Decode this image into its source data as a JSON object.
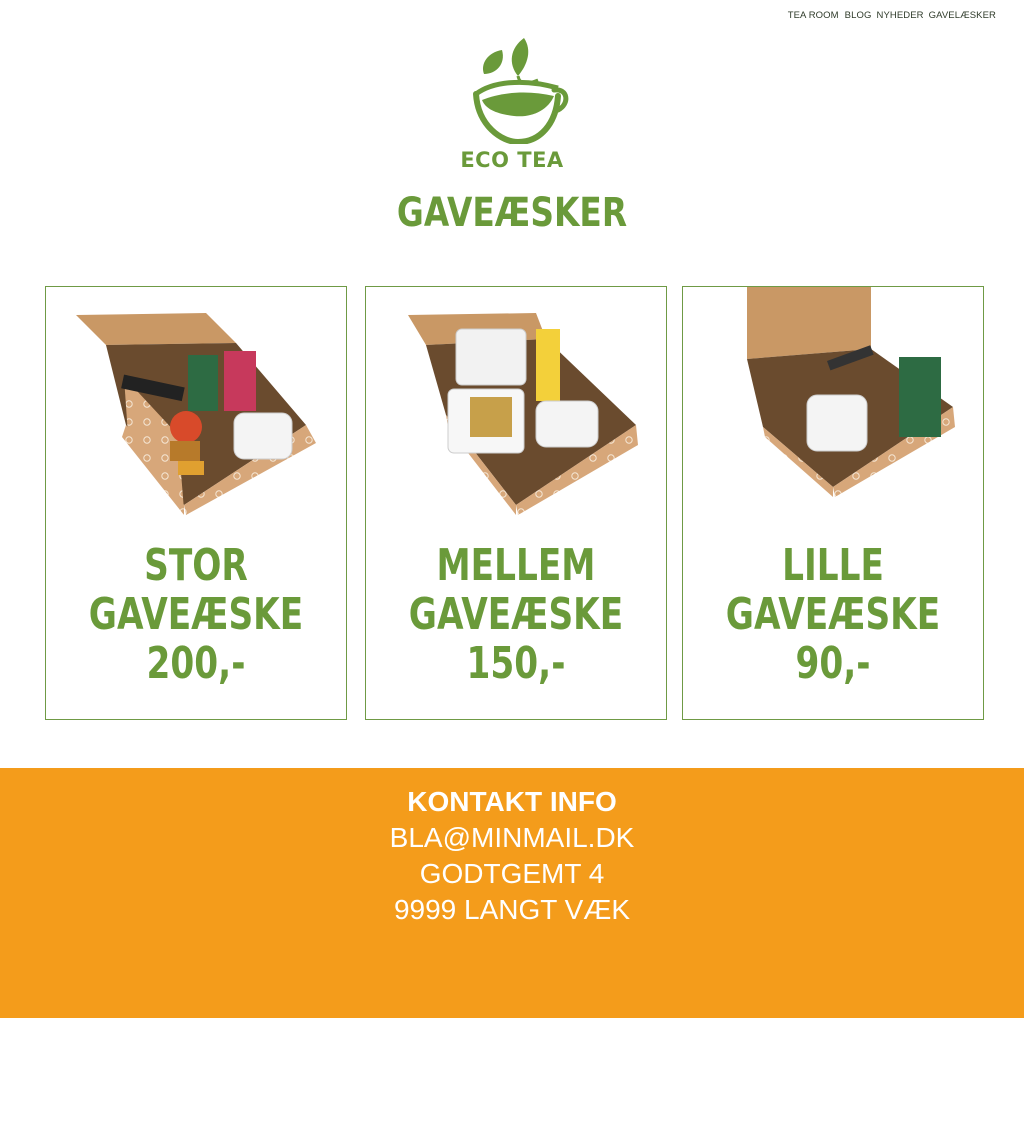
{
  "nav": {
    "items": [
      "TEA ROOM",
      "BLOG",
      "NYHEDER",
      "GAVELÆSKER"
    ]
  },
  "logo": {
    "text": "ECO TEA",
    "icon": "tea-cup-leaf-icon",
    "color": "#6a9a3a"
  },
  "page": {
    "title": "GAVEÆSKER"
  },
  "products": [
    {
      "line1": "STOR",
      "line2": "GAVEÆSKE",
      "price": "200,-"
    },
    {
      "line1": "MELLEM",
      "line2": "GAVEÆSKE",
      "price": "150,-"
    },
    {
      "line1": "LILLE",
      "line2": "GAVEÆSKE",
      "price": "90,-"
    }
  ],
  "footer": {
    "title": "KONTAKT INFO",
    "email": "BLA@MINMAIL.DK",
    "address": "GODTGEMT 4",
    "city": "9999 LANGT VÆK",
    "background": "#f49c1b"
  }
}
